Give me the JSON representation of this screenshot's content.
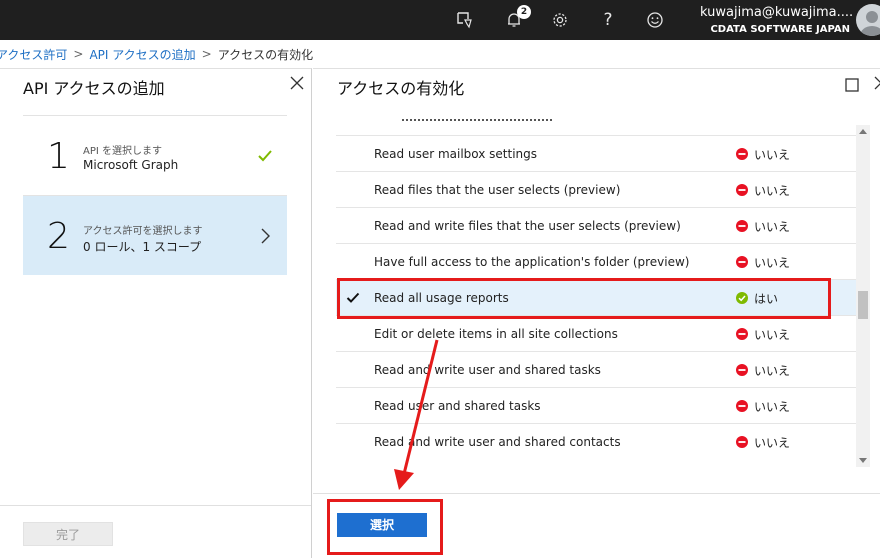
{
  "header": {
    "user_name": "kuwajima@kuwajima....",
    "org": "CDATA SOFTWARE JAPAN",
    "notification_count": "2",
    "help_label": "?",
    "icons": [
      "feedback-icon",
      "bell-icon",
      "gear-icon",
      "help-icon",
      "smiley-icon",
      "avatar"
    ]
  },
  "breadcrumb": {
    "items": [
      "アクセス許可",
      "API アクセスの追加",
      "アクセスの有効化"
    ],
    "separator": ">"
  },
  "left_panel": {
    "title": "API アクセスの追加",
    "steps": [
      {
        "number": "1",
        "label": "API を選択します",
        "value": "Microsoft Graph",
        "status": "complete"
      },
      {
        "number": "2",
        "label": "アクセス許可を選択します",
        "value": "0 ロール、1 スコープ",
        "status": "active"
      }
    ],
    "done_label": "完了"
  },
  "right_panel": {
    "title": "アクセスの有効化",
    "permissions": [
      {
        "name": "Read user mailbox settings",
        "admin": "いいえ",
        "checked": false
      },
      {
        "name": "Read files that the user selects (preview)",
        "admin": "いいえ",
        "checked": false
      },
      {
        "name": "Read and write files that the user selects (preview)",
        "admin": "いいえ",
        "checked": false
      },
      {
        "name": "Have full access to the application's folder (preview)",
        "admin": "いいえ",
        "checked": false
      },
      {
        "name": "Read all usage reports",
        "admin": "はい",
        "checked": true
      },
      {
        "name": "Edit or delete items in all site collections",
        "admin": "いいえ",
        "checked": false
      },
      {
        "name": "Read and write user and shared tasks",
        "admin": "いいえ",
        "checked": false
      },
      {
        "name": "Read user and shared tasks",
        "admin": "いいえ",
        "checked": false
      },
      {
        "name": "Read and write user and shared contacts",
        "admin": "いいえ",
        "checked": false
      }
    ],
    "select_label": "選択"
  },
  "colors": {
    "topbar": "#1f1f1f",
    "link": "#1e6fc4",
    "active_step": "#d9ebf8",
    "primary_button": "#1e6fd0",
    "status_no": "#e81123",
    "status_yes": "#7fba00",
    "annotation": "#e51b1b"
  }
}
